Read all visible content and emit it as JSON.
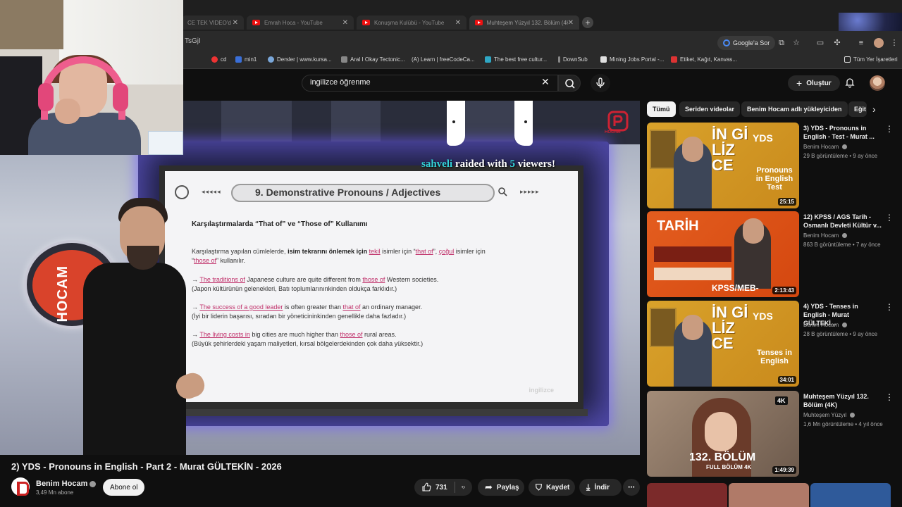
{
  "browser": {
    "tabs": [
      {
        "label": "CE TEK VIDEO'd",
        "close": "✕"
      },
      {
        "label": "Emrah Hoca - YouTube",
        "close": "✕"
      },
      {
        "label": "Konuşma Kulübü - YouTube",
        "close": "✕"
      },
      {
        "label": "Muhteşem Yüzyıl 132. Bölüm (4K",
        "close": "✕"
      }
    ],
    "new_tab": "+",
    "url_fragment": "TsGjI",
    "google_ask": "Google'a Sor",
    "bookmarks": [
      {
        "label": "cd",
        "color": "#e33"
      },
      {
        "label": "min1",
        "color": "#3a6fd8"
      },
      {
        "label": "Dersler | www.kursa...",
        "color": "#7aa7d9"
      },
      {
        "label": "Aral I Okay Tectonic...",
        "color": "#888"
      },
      {
        "label": "(A) Learn | freeCodeCa...",
        "color": "#555"
      },
      {
        "label": "The best free cultur...",
        "color": "#2fa7c4"
      },
      {
        "label": "DownSub",
        "color": "#888"
      },
      {
        "label": "Mining Jobs Portal -...",
        "color": "#e0e0e0"
      },
      {
        "label": "Etiket, Kağıt, Kanvas...",
        "color": "#d33"
      },
      {
        "label": "Tüm Yer İşaretleri",
        "color": "#ddd"
      }
    ]
  },
  "header": {
    "search_query": "ingilizce öğrenme",
    "create_label": "Oluştur"
  },
  "player": {
    "slide_title": "9. Demonstrative Pronouns / Adjectives",
    "slide_heading": "Karşılaştırmalarda “That of” ve “Those of” Kullanımı",
    "intro_a": "Karşılaştırma yapılan cümlelerde, ",
    "intro_bold": "isim tekrarını önlemek için",
    "intro_b": " ",
    "intro_tekil": "tekil",
    "intro_c": " isimler için “",
    "intro_thatof": "that of",
    "intro_d": "”, ",
    "intro_cogul": "çoğul",
    "intro_e": " isimler için",
    "intro_f": "“",
    "intro_thoseof": "those of",
    "intro_g": "” kullanılır.",
    "ex1_arrow": "→ ",
    "ex1_hl1": "The traditions of",
    "ex1_mid": " Japanese culture are quite different from ",
    "ex1_hl2": "those of",
    "ex1_end": " Western societies.",
    "ex1_tr": "(Japon kültürünün gelenekleri, Batı toplumlarınınkinden oldukça farklıdır.)",
    "ex2_arrow": "→ ",
    "ex2_hl1": "The success of a good leader",
    "ex2_mid": " is often greater than ",
    "ex2_hl2": "that of",
    "ex2_end": " an ordinary manager.",
    "ex2_tr": "(İyi bir liderin başarısı, sıradan bir yöneticininkinden genellikle daha fazladır.)",
    "ex3_arrow": "→ ",
    "ex3_hl1": "The living costs in",
    "ex3_mid": " big cities are much higher than ",
    "ex3_hl2": "those of",
    "ex3_end": " rural areas.",
    "ex3_tr": "(Büyük şehirlerdeki yaşam maliyetleri, kırsal bölgelerdekinden çok daha yüksektir.)",
    "slide_watermark": "ingilizce",
    "wall_logo": "HOCAM",
    "corner_logo": "HOCAM",
    "raid_user": "sahveli",
    "raid_mid": " raided with ",
    "raid_count": "5",
    "raid_end": " viewers!",
    "arrows_left": "◂◂◂◂◂",
    "arrows_right": "▸▸▸▸▸"
  },
  "video": {
    "title": "2) YDS - Pronouns in English - Part 2 - Murat GÜLTEKİN - 2026",
    "channel": "Benim Hocam",
    "subscribers": "3,49 Mn abone",
    "subscribe_label": "Abone ol",
    "likes": "731",
    "share_label": "Paylaş",
    "save_label": "Kaydet",
    "download_label": "İndir",
    "more": "⋯"
  },
  "sidebar": {
    "chips": [
      "Tümü",
      "Seriden videolar",
      "Benim Hocam adlı yükleyiciden",
      "Eğit"
    ],
    "next": "›",
    "recommendations": [
      {
        "title": "3) YDS - Pronouns in English - Test - Murat ...",
        "channel": "Benim Hocam",
        "meta": "29 B görüntüleme • 9 ay önce",
        "duration": "25:15",
        "thumb_big": "İN Gİ LİZ CE",
        "thumb_badge": "YDS",
        "thumb_sub": "Pronouns in English Test"
      },
      {
        "title": "12) KPSS  / AGS Tarih - Osmanlı Devleti Kültür v...",
        "channel": "Benim Hocam",
        "meta": "863 B görüntüleme • 7 ay önce",
        "duration": "2:13:43",
        "thumb_big": "TARİH",
        "thumb_badge": "",
        "thumb_sub": "KPSS/MEB-"
      },
      {
        "title": "4) YDS - Tenses in English - Murat GÜLTEKİ...",
        "channel": "Benim Hocam",
        "meta": "28 B görüntüleme • 9 ay önce",
        "duration": "34:01",
        "thumb_big": "İN Gİ LİZ CE",
        "thumb_badge": "YDS",
        "thumb_sub": "Tenses in English"
      },
      {
        "title": "Muhteşem Yüzyıl 132. Bölüm (4K)",
        "channel": "Muhteşem Yüzyıl",
        "meta": "1,6 Mn görüntüleme • 4 yıl önce",
        "duration": "1:49:39",
        "thumb_big": "132. BÖLÜM",
        "thumb_badge": "4K",
        "thumb_sub": "FULL BÖLÜM 4K"
      }
    ]
  }
}
